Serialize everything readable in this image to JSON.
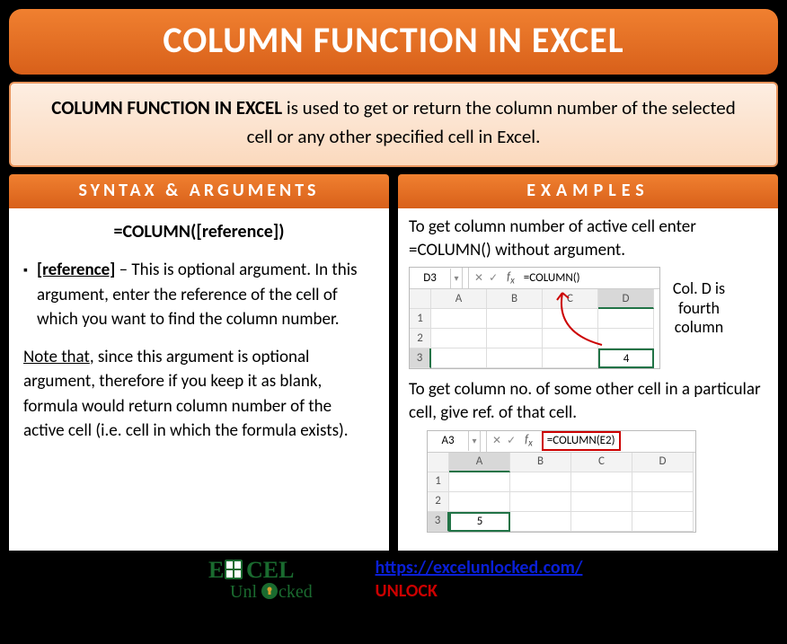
{
  "title": "COLUMN FUNCTION IN EXCEL",
  "description": {
    "bold": "COLUMN FUNCTION IN EXCEL",
    "rest": " is used to get or return the column number of the selected cell or any other specified cell in Excel."
  },
  "syntax": {
    "header": "SYNTAX & ARGUMENTS",
    "formula": "=COLUMN([reference])",
    "arg_label": "[reference]",
    "arg_text": " – This is optional argument. In this argument, enter the reference of the cell of which you want to find the column number.",
    "note_label": "Note that",
    "note_text": ", since this argument is optional argument, therefore if you keep it as blank, formula would return column number of the active cell (i.e. cell in which the formula exists)."
  },
  "examples": {
    "header": "EXAMPLES",
    "ex1_text": "To get column number of active cell enter =COLUMN() without argument.",
    "ex1_namebox": "D3",
    "ex1_formula": "=COLUMN()",
    "ex1_cols": [
      "A",
      "B",
      "C",
      "D"
    ],
    "ex1_rows": [
      "1",
      "2",
      "3"
    ],
    "ex1_value": "4",
    "ex1_sidenote": "Col. D is fourth column",
    "ex2_text": "To get column no. of some other cell in a particular cell, give ref. of that cell.",
    "ex2_namebox": "A3",
    "ex2_formula": "=COLUMN(E2)",
    "ex2_cols": [
      "A",
      "B",
      "C",
      "D"
    ],
    "ex2_rows": [
      "1",
      "2",
      "3"
    ],
    "ex2_value": "5"
  },
  "footer": {
    "logo_excel": "E   CEL",
    "logo_unlocked": "Unl cked",
    "url": "https://excelunlocked.com/",
    "unlock": "UNLOCK"
  }
}
